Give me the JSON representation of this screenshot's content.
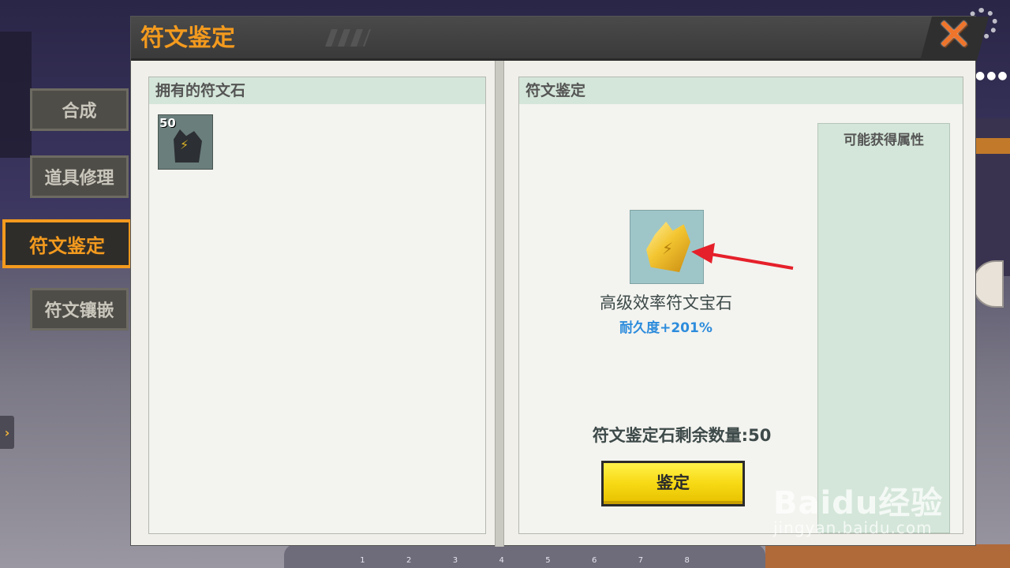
{
  "dialog": {
    "title": "符文鉴定",
    "close_icon": "close-x-icon"
  },
  "side_tabs": [
    {
      "label": "合成",
      "active": false
    },
    {
      "label": "道具修理",
      "active": false
    },
    {
      "label": "符文鉴定",
      "active": true
    },
    {
      "label": "符文镶嵌",
      "active": false
    }
  ],
  "left_panel": {
    "header": "拥有的符文石",
    "items": [
      {
        "count": "50",
        "icon": "dark-rune-stone-icon"
      }
    ]
  },
  "right_panel": {
    "header": "符文鉴定",
    "gem": {
      "icon": "gold-rune-gem-icon",
      "name": "高级效率符文宝石",
      "attribute": "耐久度+201%"
    },
    "possible_attributes_title": "可能获得属性",
    "remaining_text": "符文鉴定石剩余数量:50",
    "identify_button": "鉴定"
  },
  "hotbar": {
    "slots": [
      "1",
      "2",
      "3",
      "4",
      "5",
      "6",
      "7",
      "8"
    ]
  },
  "side_toggle_icon": "chevron-right-icon",
  "watermark": {
    "logo": "Baidu经验",
    "url": "jingyan.baidu.com"
  },
  "colors": {
    "accent_orange": "#f39a1e",
    "panel_header_green": "#d4e6d9",
    "attribute_blue": "#2d8cdc",
    "button_yellow": "#f7d914",
    "annotation_red": "#e5202a"
  }
}
